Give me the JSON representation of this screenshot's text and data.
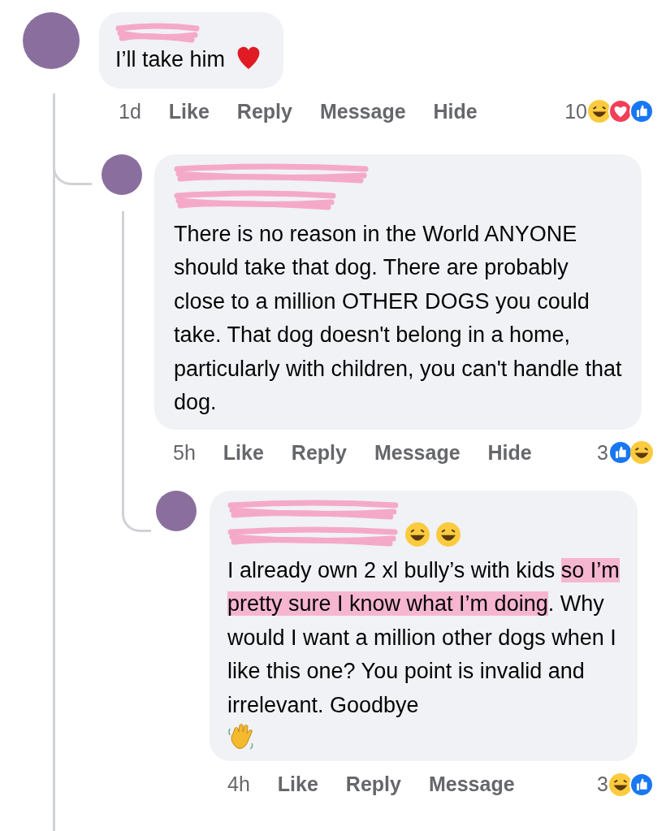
{
  "comments": [
    {
      "segments": [
        {
          "kind": "text",
          "text": "I’ll take him"
        },
        {
          "kind": "heart"
        }
      ],
      "time": "1d",
      "actions": [
        "Like",
        "Reply",
        "Message",
        "Hide"
      ],
      "reaction_count": "10",
      "reactions": [
        {
          "kind": "haha"
        },
        {
          "kind": "love"
        },
        {
          "kind": "like"
        }
      ],
      "children": [
        {
          "segments": [
            {
              "kind": "text",
              "parts": [
                {
                  "text": "There is no reason in the World ANYONE should take that dog. There are probably close to a million OTHER DOGS you could take.  That dog doesn't belong in a home, particularly with children, you can't handle that dog.",
                  "highlighted": false
                }
              ]
            }
          ],
          "time": "5h",
          "actions": [
            "Like",
            "Reply",
            "Message",
            "Hide"
          ],
          "reaction_count": "3",
          "reactions": [
            {
              "kind": "like"
            },
            {
              "kind": "haha"
            }
          ],
          "children": [
            {
              "segments": [
                {
                  "kind": "haha"
                },
                {
                  "kind": "haha"
                },
                {
                  "kind": "text",
                  "parts": [
                    {
                      "text": "I already own 2 xl bully’s with kids ",
                      "highlighted": false
                    },
                    {
                      "text": "so I’m pretty sure I know what I’m doing",
                      "highlighted": true
                    },
                    {
                      "text": ". Why would I want a million other dogs when I like this one? You point is invalid and irrelevant. Goodbye",
                      "highlighted": false
                    }
                  ]
                },
                {
                  "kind": "wave"
                }
              ],
              "time": "4h",
              "actions": [
                "Like",
                "Reply",
                "Message"
              ],
              "reaction_count": "3",
              "reactions": [
                {
                  "kind": "haha"
                },
                {
                  "kind": "like"
                }
              ]
            }
          ]
        }
      ]
    }
  ]
}
